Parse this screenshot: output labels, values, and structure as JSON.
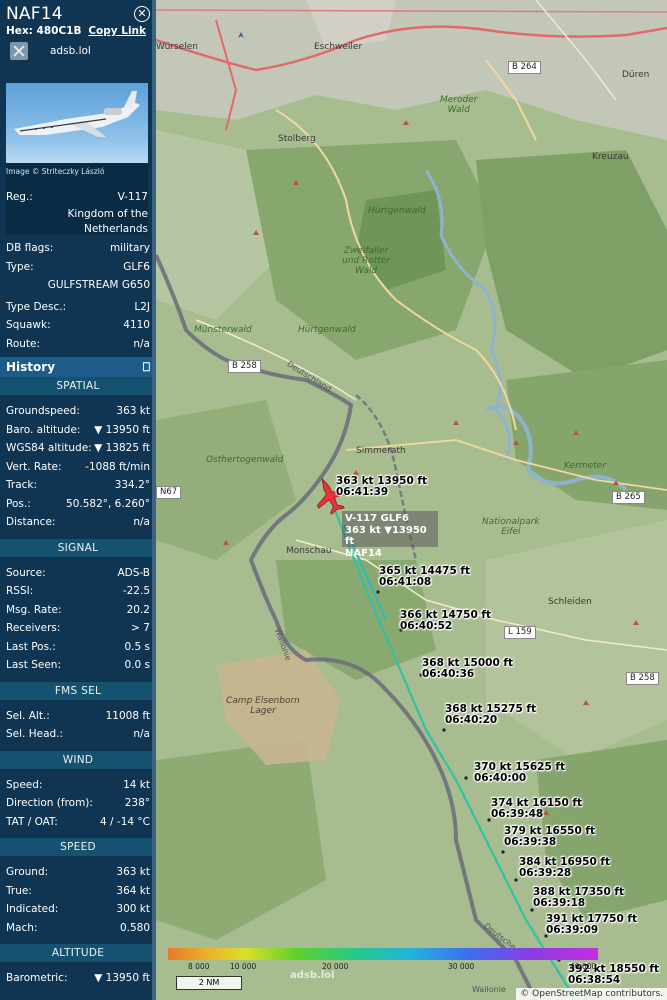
{
  "sidebar": {
    "callsign": "NAF14",
    "hex_label": "Hex: 480C1B",
    "copy_link": "Copy Link",
    "source_site": "adsb.lol",
    "photo_credit": "Image © Striteczky László",
    "reg_label": "Reg.:",
    "reg_value": "V-117",
    "owner_line1": "Kingdom of the",
    "owner_line2": "Netherlands",
    "dbflags_label": "DB flags:",
    "dbflags_value": "military",
    "type_label": "Type:",
    "type_value": "GLF6",
    "type_name": "GULFSTREAM G650",
    "typedesc_label": "Type Desc.:",
    "typedesc_value": "L2J",
    "squawk_label": "Squawk:",
    "squawk_value": "4110",
    "route_label": "Route:",
    "route_value": "n/a",
    "history_label": "History",
    "history_icon": "⎕",
    "spatial": {
      "title": "SPATIAL",
      "rows": [
        {
          "k": "Groundspeed:",
          "v": "363 kt"
        },
        {
          "k": "Baro. altitude:",
          "v": "▼ 13950 ft"
        },
        {
          "k": "WGS84 altitude:",
          "v": "▼ 13825 ft"
        },
        {
          "k": "Vert. Rate:",
          "v": "-1088 ft/min"
        },
        {
          "k": "Track:",
          "v": "334.2°"
        },
        {
          "k": "Pos.:",
          "v": "50.582°, 6.260°"
        },
        {
          "k": "Distance:",
          "v": "n/a"
        }
      ]
    },
    "signal": {
      "title": "SIGNAL",
      "rows": [
        {
          "k": "Source:",
          "v": "ADS-B"
        },
        {
          "k": "RSSI:",
          "v": "-22.5"
        },
        {
          "k": "Msg. Rate:",
          "v": "20.2"
        },
        {
          "k": "Receivers:",
          "v": "> 7"
        },
        {
          "k": "Last Pos.:",
          "v": "0.5 s"
        },
        {
          "k": "Last Seen:",
          "v": "0.0 s"
        }
      ]
    },
    "fms": {
      "title": "FMS SEL",
      "rows": [
        {
          "k": "Sel. Alt.:",
          "v": "11008 ft"
        },
        {
          "k": "Sel. Head.:",
          "v": "n/a"
        }
      ]
    },
    "wind": {
      "title": "WIND",
      "rows": [
        {
          "k": "Speed:",
          "v": "14 kt"
        },
        {
          "k": "Direction (from):",
          "v": "238°"
        },
        {
          "k": "TAT / OAT:",
          "v": "4 / -14 °C"
        }
      ]
    },
    "speed": {
      "title": "SPEED",
      "rows": [
        {
          "k": "Ground:",
          "v": "363 kt"
        },
        {
          "k": "True:",
          "v": "364 kt"
        },
        {
          "k": "Indicated:",
          "v": "300 kt"
        },
        {
          "k": "Mach:",
          "v": "0.580"
        }
      ]
    },
    "altitude": {
      "title": "ALTITUDE",
      "rows": [
        {
          "k": "Barometric:",
          "v": "▼ 13950 ft"
        }
      ]
    }
  },
  "map": {
    "places": {
      "wurselen": "Würselen",
      "eschweiler": "Eschweiler",
      "duren": "Düren",
      "stolberg": "Stolberg",
      "kreuzau": "Kreuzau",
      "simmerath": "Simmerath",
      "monschau": "Monschau",
      "schleiden": "Schleiden",
      "hurtgenwald1": "Hürtgenwald",
      "hurtgenwald2": "Hürtgenwald",
      "merode1": "Meroder",
      "merode2": "Wald",
      "zweifaller1": "Zweifaller",
      "zweifaller2": "und Rotter",
      "zweifaller3": "Wald",
      "munsterwald": "Münsterwald",
      "osthertogenwald": "Osthertogenwald",
      "kermeter": "Kermeter",
      "nationalpark1": "Nationalpark",
      "nationalpark2": "Eifel",
      "camp1": "Camp Elsenborn",
      "camp2": "Lager",
      "wallonie1": "Wallonie",
      "wallonie2": "Wallonie",
      "deutschland1": "Deutschland",
      "deutschland2": "Deutsche"
    },
    "roads": {
      "b264": "B 264",
      "b258a": "B 258",
      "b258b": "B 258",
      "b265": "B 265",
      "n67": "N67",
      "l159": "L 159"
    },
    "selected_label": {
      "line1": "V-117 GLF6",
      "line2": "363 kt  ▼13950 ft",
      "line3": "NAF14"
    },
    "track_labels": [
      {
        "speed": "363 kt",
        "alt": "13950 ft",
        "time": "06:41:39"
      },
      {
        "speed": "365 kt",
        "alt": "14475 ft",
        "time": "06:41:08"
      },
      {
        "speed": "366 kt",
        "alt": "14750 ft",
        "time": "06:40:52"
      },
      {
        "speed": "368 kt",
        "alt": "15000 ft",
        "time": "06:40:36"
      },
      {
        "speed": "368 kt",
        "alt": "15275 ft",
        "time": "06:40:20"
      },
      {
        "speed": "370 kt",
        "alt": "15625 ft",
        "time": "06:40:00"
      },
      {
        "speed": "374 kt",
        "alt": "16150 ft",
        "time": "06:39:48"
      },
      {
        "speed": "379 kt",
        "alt": "16550 ft",
        "time": "06:39:38"
      },
      {
        "speed": "384 kt",
        "alt": "16950 ft",
        "time": "06:39:28"
      },
      {
        "speed": "388 kt",
        "alt": "17350 ft",
        "time": "06:39:18"
      },
      {
        "speed": "391 kt",
        "alt": "17750 ft",
        "time": "06:39:09"
      },
      {
        "speed": "392 kt",
        "alt": "18550 ft",
        "time": "06:38:54"
      }
    ],
    "legend_ticks": [
      "8 000",
      "10 000",
      "20 000",
      "30 000",
      "40 000"
    ],
    "scale": "2 NM",
    "watermark": "adsb.lol",
    "attribution": "© OpenStreetMap contributors."
  },
  "colors": {
    "sidebar_bg": "#0f3552",
    "history_bg": "#1d5b8b",
    "section_bg": "#14526f",
    "track": "#2fc2a6",
    "aircraft": "#e8323c",
    "border": "#6b6b7a"
  }
}
